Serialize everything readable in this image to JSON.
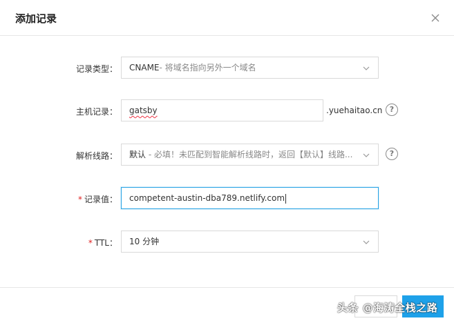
{
  "dialog": {
    "title": "添加记录",
    "close_icon": "close-icon"
  },
  "form": {
    "record_type": {
      "label": "记录类型：",
      "value_main": "CNAME",
      "value_hint": "- 将域名指向另外一个域名",
      "icon": "chevron-down-icon"
    },
    "host_record": {
      "label": "主机记录：",
      "value": "gatsby",
      "suffix": ".yuehaitao.cn",
      "help_icon": "?"
    },
    "resolution_line": {
      "label": "解析线路：",
      "value_main": "默认",
      "value_hint": " - 必填！未匹配到智能解析线路时，返回【默认】线路...",
      "icon": "chevron-down-icon",
      "help_icon": "?"
    },
    "record_value": {
      "required_mark": "*",
      "label": "记录值：",
      "value": "competent-austin-dba789.netlify.com"
    },
    "ttl": {
      "required_mark": "*",
      "label": "TTL：",
      "value": "10 分钟",
      "icon": "chevron-down-icon"
    }
  },
  "watermark": "头条 @海涛全栈之路",
  "colors": {
    "primary": "#1ea1e9",
    "required": "#e02020",
    "focus_border": "#27a3e4"
  }
}
